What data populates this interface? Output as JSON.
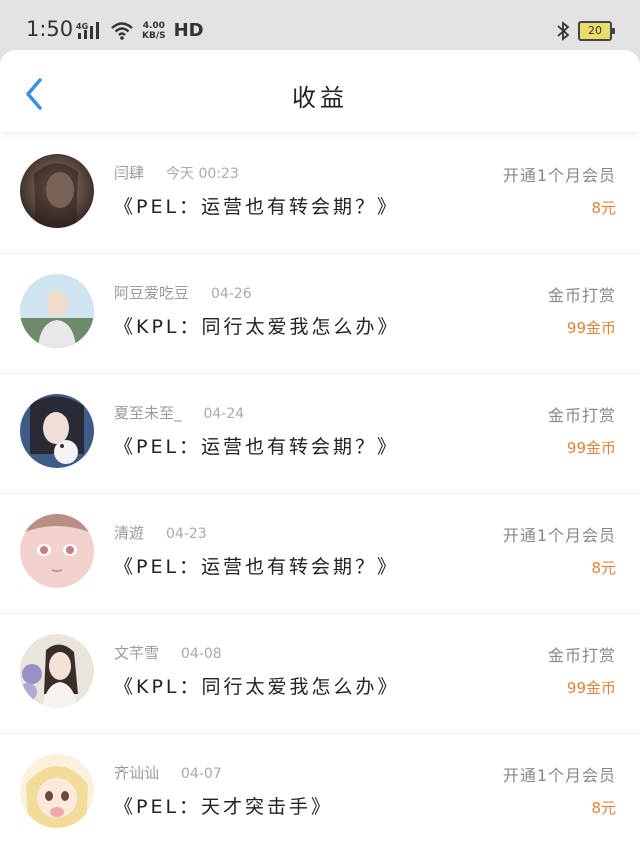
{
  "status_bar": {
    "time": "1:50",
    "network": "4G",
    "speed_value": "4.00",
    "speed_unit": "KB/S",
    "hd": "HD",
    "battery": "20"
  },
  "header": {
    "title": "收益"
  },
  "items": [
    {
      "name": "闫肆",
      "date": "今天 00:23",
      "title": "《PEL：运营也有转会期？》",
      "type": "开通1个月会员",
      "amount": "8元"
    },
    {
      "name": "阿豆爱吃豆",
      "date": "04-26",
      "title": "《KPL：同行太爱我怎么办》",
      "type": "金币打赏",
      "amount": "99金币"
    },
    {
      "name": "夏至未至_",
      "date": "04-24",
      "title": "《PEL：运营也有转会期？》",
      "type": "金币打赏",
      "amount": "99金币"
    },
    {
      "name": "清遊",
      "date": "04-23",
      "title": "《PEL：运营也有转会期？》",
      "type": "开通1个月会员",
      "amount": "8元"
    },
    {
      "name": "文芊雪",
      "date": "04-08",
      "title": "《KPL：同行太爱我怎么办》",
      "type": "金币打赏",
      "amount": "99金币"
    },
    {
      "name": "齐讪讪",
      "date": "04-07",
      "title": "《PEL：天才突击手》",
      "type": "开通1个月会员",
      "amount": "8元"
    }
  ],
  "colors": {
    "accent": "#3a8ee6",
    "amount": "#e0843b",
    "status_bar_bg": "#e3e3e3"
  }
}
